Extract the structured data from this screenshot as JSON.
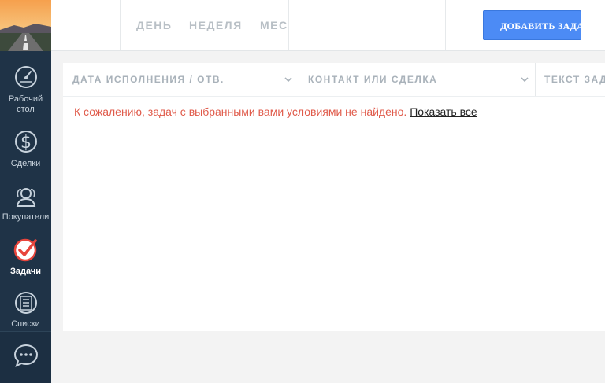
{
  "sidebar": {
    "items": [
      {
        "label": "Рабочий стол",
        "icon": "speedometer-icon"
      },
      {
        "label": "Сделки",
        "icon": "dollar-icon"
      },
      {
        "label": "Покупатели",
        "icon": "buyers-icon"
      },
      {
        "label": "Задачи",
        "icon": "checkmark-icon",
        "active": true
      },
      {
        "label": "Списки",
        "icon": "list-icon"
      }
    ],
    "chat_icon": "chat-bubble-icon"
  },
  "topbar": {
    "tabs": [
      "ДЕНЬ",
      "НЕДЕЛЯ",
      "МЕСЯЦ"
    ],
    "add_button": "ДОБАВИТЬ ЗАДАЧУ"
  },
  "table": {
    "columns": [
      "ДАТА ИСПОЛНЕНИЯ / ОТВ.",
      "КОНТАКТ ИЛИ СДЕЛКА",
      "ТЕКСТ ЗАДАЧИ"
    ],
    "empty_message": "К сожалению, задач с выбранными вами условиями не найдено.",
    "show_all_link": "Показать все"
  },
  "colors": {
    "sidebar_bg": "#1f3347",
    "accent_blue": "#4c8bf5",
    "empty_text": "#e05b4b",
    "active_icon": "#e8453c"
  }
}
